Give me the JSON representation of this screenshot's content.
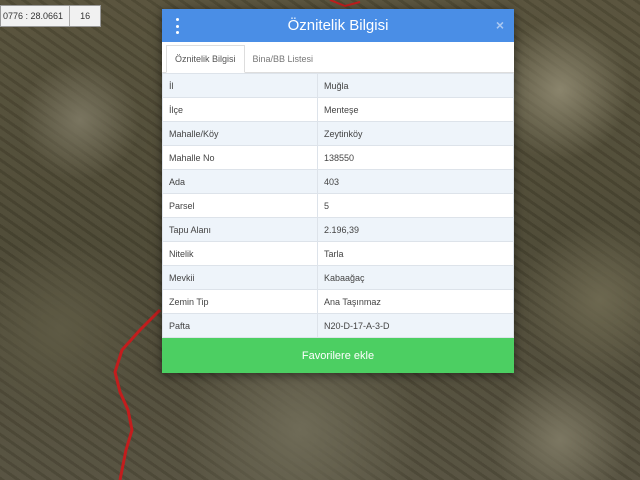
{
  "map": {
    "coordinates": "0776 : 28.0661",
    "zoom_level": "16",
    "road_color": "#c21d1d"
  },
  "dialog": {
    "title": "Öznitelik Bilgisi",
    "close_label": "×",
    "accent_color": "#4a8ee6",
    "tabs": [
      {
        "label": "Öznitelik Bilgisi",
        "active": true
      },
      {
        "label": "Bina/BB Listesi",
        "active": false
      }
    ],
    "rows": [
      {
        "key": "İl",
        "value": "Muğla"
      },
      {
        "key": "İlçe",
        "value": "Menteşe"
      },
      {
        "key": "Mahalle/Köy",
        "value": "Zeytinköy"
      },
      {
        "key": "Mahalle No",
        "value": "138550"
      },
      {
        "key": "Ada",
        "value": "403"
      },
      {
        "key": "Parsel",
        "value": "5"
      },
      {
        "key": "Tapu Alanı",
        "value": "2.196,39"
      },
      {
        "key": "Nitelik",
        "value": "Tarla"
      },
      {
        "key": "Mevkii",
        "value": "Kabaağaç"
      },
      {
        "key": "Zemin Tip",
        "value": "Ana Taşınmaz"
      },
      {
        "key": "Pafta",
        "value": "N20-D-17-A-3-D"
      }
    ],
    "favorite_button": "Favorilere ekle",
    "favorite_color": "#4ccf62"
  }
}
